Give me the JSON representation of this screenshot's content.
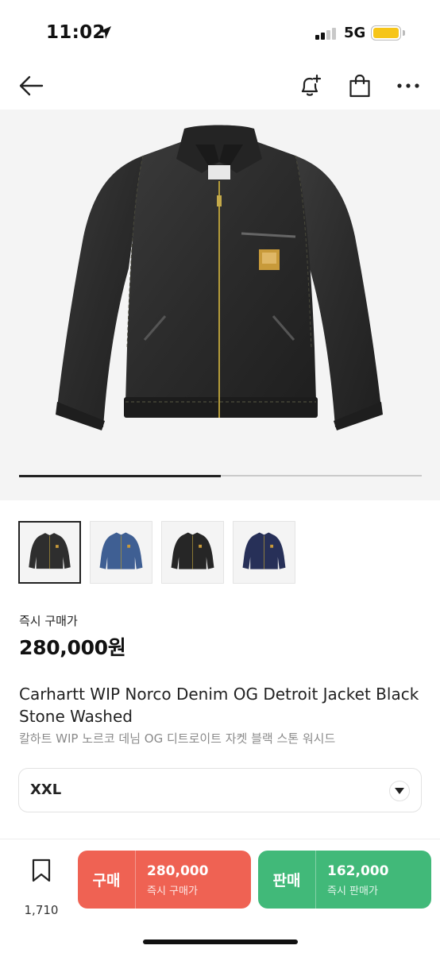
{
  "status_bar": {
    "time": "11:02",
    "network": "5G",
    "battery_color": "#f6c518"
  },
  "nav": {
    "back_icon": "arrow-left-icon",
    "alert_icon": "bell-plus-icon",
    "bag_icon": "shopping-bag-icon",
    "more_icon": "more-horizontal-icon"
  },
  "gallery": {
    "progress": 0.5,
    "thumbnails": [
      {
        "label": "black-stone-washed",
        "color": "#2e2e2e",
        "selected": true
      },
      {
        "label": "blue-denim",
        "color": "#3f5f93",
        "selected": false
      },
      {
        "label": "black",
        "color": "#262626",
        "selected": false
      },
      {
        "label": "navy",
        "color": "#273058",
        "selected": false
      }
    ]
  },
  "price": {
    "label": "즉시 구매가",
    "value": "280,000원"
  },
  "product": {
    "title_en": "Carhartt WIP Norco Denim OG Detroit Jacket Black Stone Washed",
    "title_ko": "칼하트 WIP 노르코 데님 OG 디트로이트 자켓 블랙 스톤 워시드"
  },
  "size_select": {
    "value": "XXL"
  },
  "bottom_bar": {
    "wish_count": "1,710",
    "buy": {
      "label": "구매",
      "price": "280,000",
      "sub": "즉시 구매가",
      "color": "#ef6253"
    },
    "sell": {
      "label": "판매",
      "price": "162,000",
      "sub": "즉시 판매가",
      "color": "#41b979"
    }
  }
}
